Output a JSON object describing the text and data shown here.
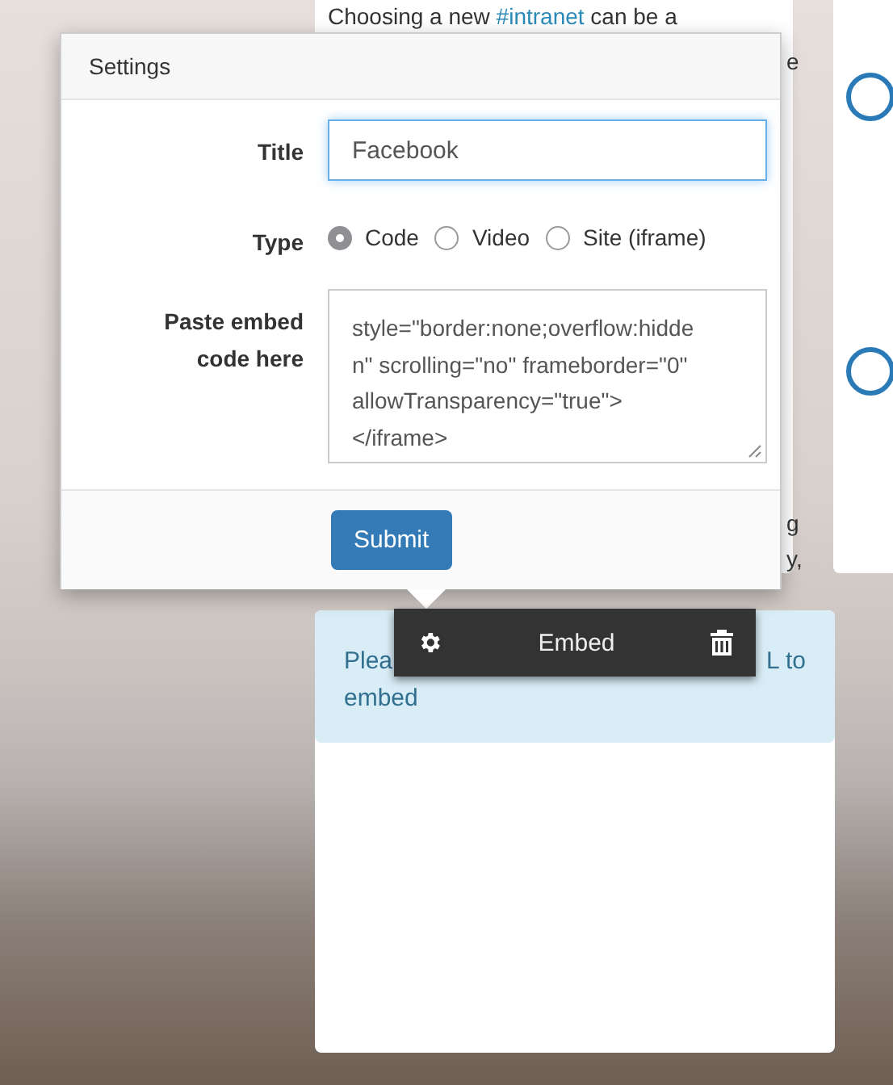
{
  "background_card": {
    "intro": "Choosing a new ",
    "hashtag": "#intranet",
    "rest": " can be a",
    "fragments": [
      "e",
      "g",
      "y,"
    ]
  },
  "settings": {
    "title": "Settings",
    "fields": [
      {
        "kind": "text",
        "label": "Title",
        "value": "Facebook"
      },
      {
        "kind": "radio",
        "label": "Type",
        "options": [
          {
            "label": "Code",
            "selected": true
          },
          {
            "label": "Video",
            "selected": false
          },
          {
            "label": "Site (iframe)",
            "selected": false
          }
        ]
      },
      {
        "kind": "code",
        "label": "Paste embed code here",
        "lines": [
          "style=\"border:none;overflow:hidde",
          "n\" scrolling=\"no\" frameborder=\"0\"",
          "allowTransparency=\"true\">",
          "</iframe>"
        ]
      }
    ],
    "submit": "Submit"
  },
  "toolbar": {
    "label": "Embed"
  },
  "alert": {
    "line_start": "Plea",
    "line_end": "L to",
    "line_2": "embed"
  }
}
